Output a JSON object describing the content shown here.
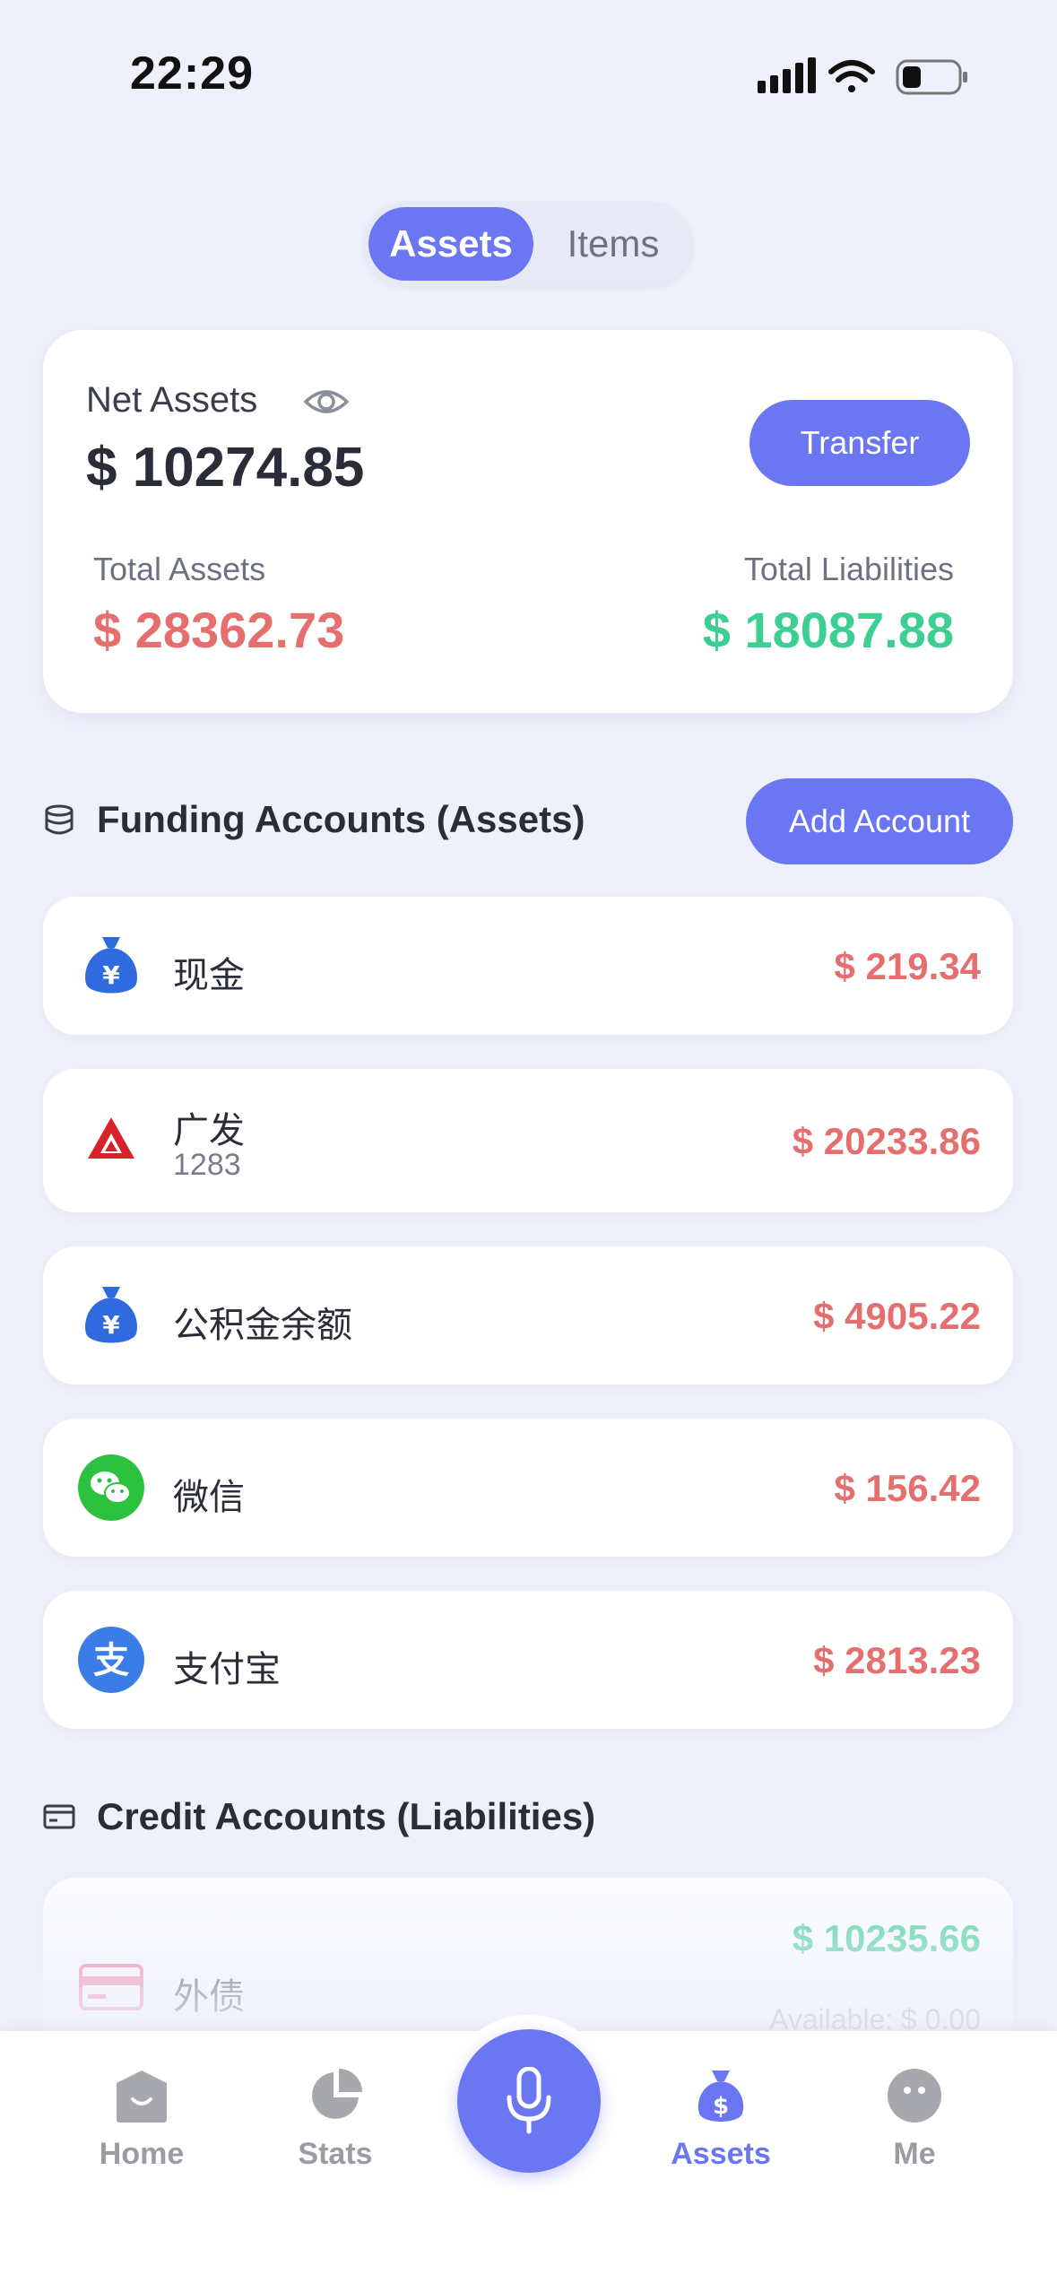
{
  "status_bar": {
    "time": "22:29"
  },
  "segment": {
    "assets_label": "Assets",
    "items_label": "Items",
    "selected": "Assets"
  },
  "summary": {
    "net_label": "Net Assets",
    "net_value": "$ 10274.85",
    "transfer_label": "Transfer",
    "total_assets_label": "Total Assets",
    "total_assets_value": "$ 28362.73",
    "total_liabilities_label": "Total Liabilities",
    "total_liabilities_value": "$ 18087.88"
  },
  "funding": {
    "title": "Funding Accounts (Assets)",
    "add_label": "Add Account",
    "accounts": [
      {
        "name": "现金",
        "sub": "",
        "amount": "$ 219.34",
        "icon": "money-bag-icon"
      },
      {
        "name": "广发",
        "sub": "1283",
        "amount": "$ 20233.86",
        "icon": "cgb-bank-icon"
      },
      {
        "name": "公积金余额",
        "sub": "",
        "amount": "$ 4905.22",
        "icon": "money-bag-icon"
      },
      {
        "name": "微信",
        "sub": "",
        "amount": "$ 156.42",
        "icon": "wechat-icon"
      },
      {
        "name": "支付宝",
        "sub": "",
        "amount": "$ 2813.23",
        "icon": "alipay-icon"
      }
    ]
  },
  "credit": {
    "title": "Credit Accounts (Liabilities)",
    "accounts": [
      {
        "name": "外债",
        "amount": "$ 10235.66",
        "available": "Available: $ 0.00",
        "icon": "credit-card-icon"
      }
    ]
  },
  "tabbar": {
    "home": "Home",
    "stats": "Stats",
    "assets": "Assets",
    "me": "Me",
    "active": "Assets"
  },
  "colors": {
    "accent": "#6b76f2",
    "asset_red": "#e56f6f",
    "liability_green": "#3ccf91",
    "background": "#eef0fb"
  }
}
